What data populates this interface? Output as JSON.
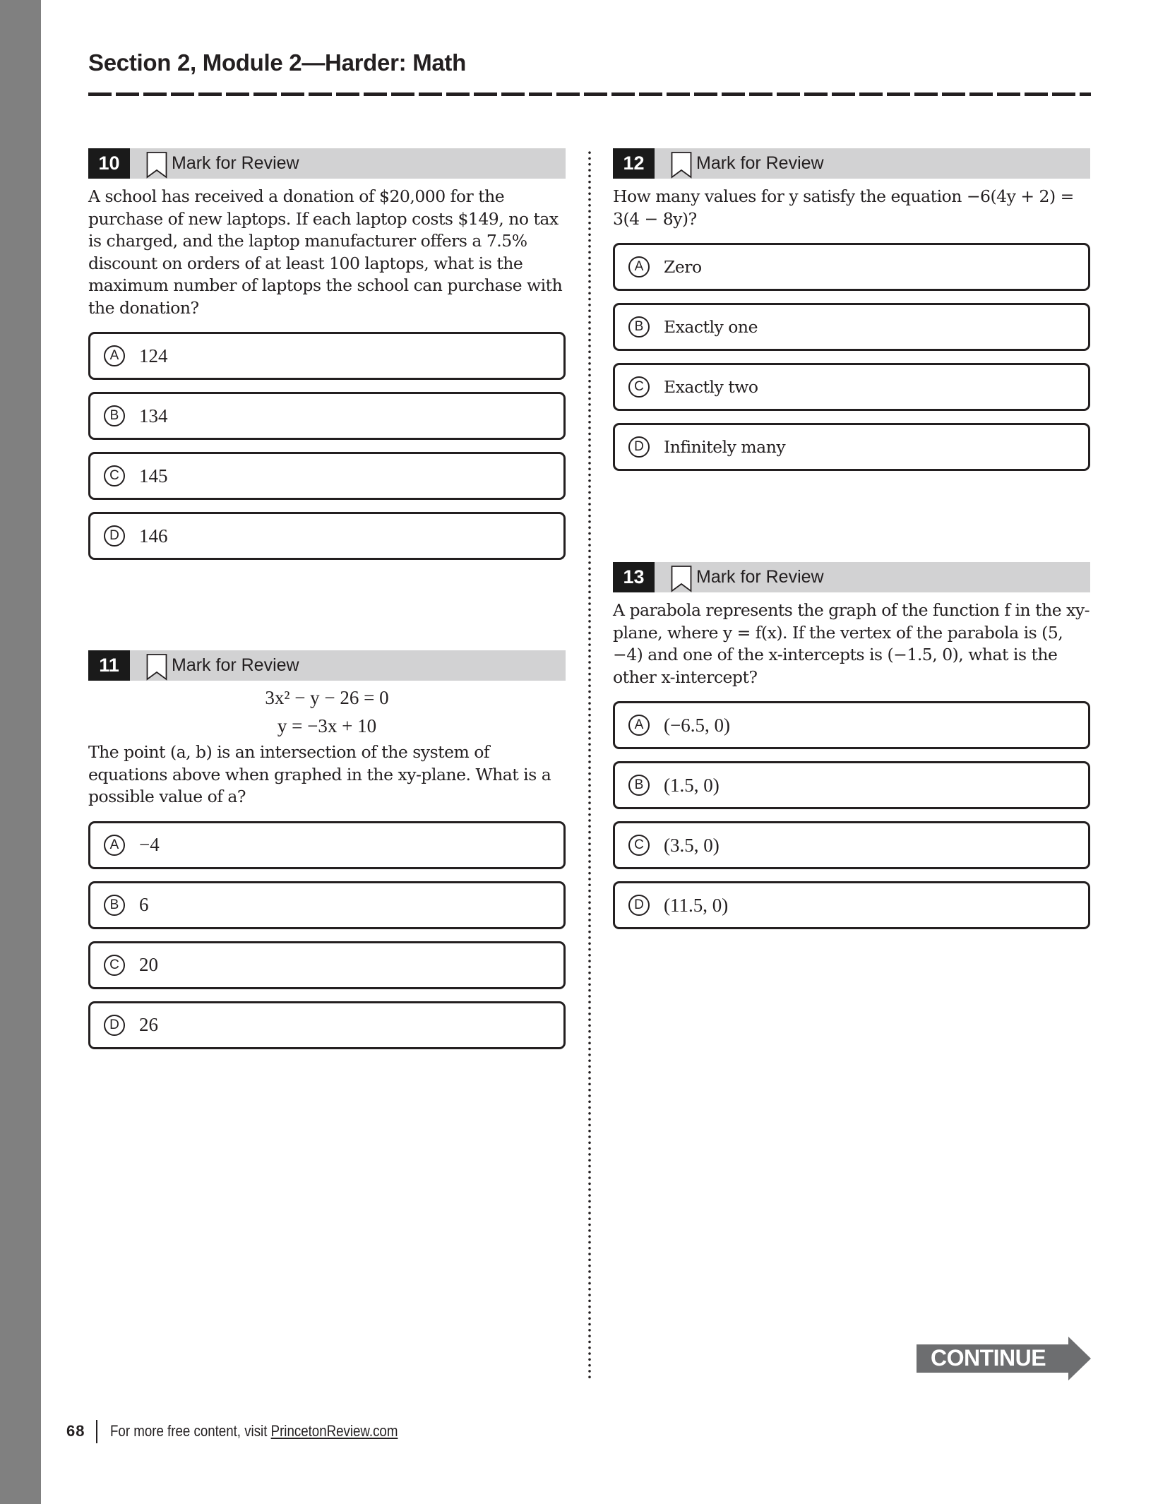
{
  "page": {
    "section_title": "Section 2, Module 2—Harder: Math",
    "page_number": "68",
    "footer_text": "For more free content, visit ",
    "footer_link": "PrincetonReview.com",
    "continue_label": "CONTINUE"
  },
  "colors": {
    "header_band": "#d2d2d3",
    "number_box": "#1a1a1a",
    "side_bar": "#808080",
    "continue_arrow": "#6d6e70"
  },
  "questions": [
    {
      "number": "10",
      "mark_label": "Mark for Review",
      "text": "A school has received a donation of $20,000 for the purchase of new laptops. If each laptop costs $149, no tax is charged, and the laptop manufacturer offers a 7.5% discount on orders of at least 100 laptops, what is the maximum number of laptops the school can purchase with the donation?",
      "choices": [
        {
          "letter": "A",
          "text": "124"
        },
        {
          "letter": "B",
          "text": "134"
        },
        {
          "letter": "C",
          "text": "145"
        },
        {
          "letter": "D",
          "text": "146"
        }
      ]
    },
    {
      "number": "11",
      "mark_label": "Mark for Review",
      "equations": [
        "3x² − y − 26 = 0",
        "y = −3x + 10"
      ],
      "text": "The point (a, b) is an intersection of the system of equations above when graphed in the xy-plane. What is a possible value of a?",
      "choices": [
        {
          "letter": "A",
          "text": "−4"
        },
        {
          "letter": "B",
          "text": "6"
        },
        {
          "letter": "C",
          "text": "20"
        },
        {
          "letter": "D",
          "text": "26"
        }
      ]
    },
    {
      "number": "12",
      "mark_label": "Mark for Review",
      "text": "How many values for y satisfy the equation −6(4y + 2) = 3(4 − 8y)?",
      "choices": [
        {
          "letter": "A",
          "text": "Zero"
        },
        {
          "letter": "B",
          "text": "Exactly one"
        },
        {
          "letter": "C",
          "text": "Exactly two"
        },
        {
          "letter": "D",
          "text": "Infinitely many"
        }
      ]
    },
    {
      "number": "13",
      "mark_label": "Mark for Review",
      "text": "A parabola represents the graph of the function f in the xy-plane, where y = f(x). If the vertex of the parabola is (5, −4) and one of the x-intercepts is (−1.5, 0), what is the other x-intercept?",
      "choices": [
        {
          "letter": "A",
          "text": "(−6.5, 0)"
        },
        {
          "letter": "B",
          "text": "(1.5, 0)"
        },
        {
          "letter": "C",
          "text": "(3.5, 0)"
        },
        {
          "letter": "D",
          "text": "(11.5, 0)"
        }
      ]
    }
  ]
}
